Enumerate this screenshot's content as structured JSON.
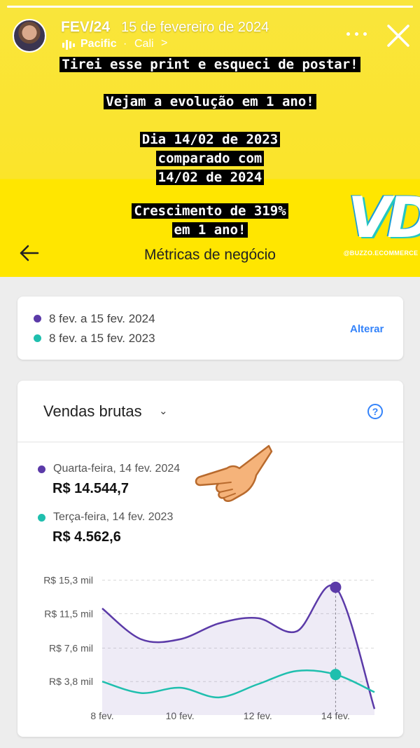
{
  "story": {
    "title": "FEV/24",
    "date": "15 de fevereiro de 2024",
    "progress": 1.0,
    "music_title": "Pacific",
    "music_sep": "·",
    "music_artist": "Cali",
    "music_chevron": ">",
    "icons": [
      "sound-bars-icon",
      "more-icon",
      "close-icon"
    ]
  },
  "overlay": {
    "line1": "Tirei esse print e esqueci de postar!",
    "line2": "Vejam a evolução em 1 ano!",
    "line3": "Dia 14/02 de 2023",
    "line4": "comparado com",
    "line5": "14/02 de 2024",
    "line6": "Crescimento de 319%",
    "line7": "em 1 ano!"
  },
  "sticker": {
    "logo_text": "VDV",
    "logo_sub": "@BUZZO.ECOMMERCE"
  },
  "header": {
    "title": "Métricas de negócio",
    "back_icon": "arrow-left-icon"
  },
  "periods": {
    "current": "8 fev. a 15 fev. 2024",
    "previous": "8 fev. a 15 fev. 2023",
    "change_label": "Alterar"
  },
  "sales": {
    "title": "Vendas brutas",
    "chevron": "⌄",
    "help": "?",
    "current_day": "Quarta-feira, 14 fev. 2024",
    "current_value": "R$ 14.544,7",
    "previous_day": "Terça-feira, 14 fev. 2023",
    "previous_value": "R$ 4.562,6"
  },
  "colors": {
    "yellow": "#ffe600",
    "purple": "#5b3aa8",
    "teal": "#1fbfae",
    "blue": "#3483fa"
  },
  "chart_data": {
    "type": "line",
    "x": [
      8,
      9,
      10,
      11,
      12,
      13,
      14,
      15
    ],
    "x_tick_labels": [
      "8 fev.",
      "10 fev.",
      "12 fev.",
      "14 fev."
    ],
    "x_ticks": [
      8,
      10,
      12,
      14
    ],
    "y_tick_labels": [
      "R$ 15,3 mil",
      "R$ 11,5 mil",
      "R$ 7,6 mil",
      "R$ 3,8 mil"
    ],
    "y_ticks": [
      15.3,
      11.5,
      7.6,
      3.8
    ],
    "ylim": [
      0,
      17.5
    ],
    "series": [
      {
        "values": [
          12.1,
          8.6,
          8.6,
          10.4,
          11.0,
          9.5,
          14.5,
          0.7
        ],
        "color": "#5b3aa8"
      },
      {
        "values": [
          3.8,
          2.5,
          3.1,
          2.0,
          3.5,
          5.0,
          4.6,
          2.6
        ],
        "color": "#1fbfae"
      }
    ],
    "highlight_x": 14,
    "grid": true
  }
}
